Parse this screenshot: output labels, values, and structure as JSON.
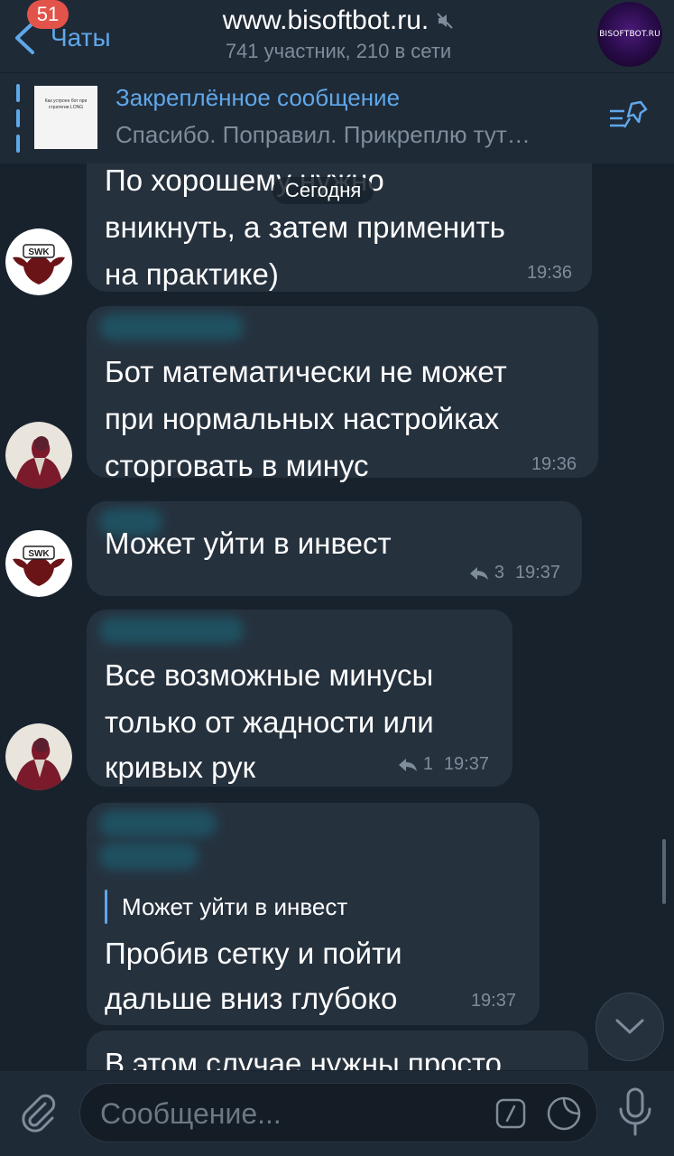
{
  "header": {
    "back_label": "Чаты",
    "unread_badge": "51",
    "title": "www.bisoftbot.ru.",
    "subtitle": "741 участник, 210 в сети",
    "channel_avatar_text": "BISOFTBOT.RU"
  },
  "pinned": {
    "title": "Закреплённое сообщение",
    "text": "Спасибо. Поправил. Прикреплю тут…",
    "thumb_text": "Как устроен бот при стратегии LONG"
  },
  "date_pill": "Сегодня",
  "messages": [
    {
      "lines": [
        "По хорошему нужно",
        "вникнуть, а затем применить",
        "на практике)"
      ],
      "time": "19:36",
      "avatar": "swk-bull"
    },
    {
      "lines": [
        "Бот математически не может",
        "при нормальных настройках",
        "сторговать в минус"
      ],
      "time": "19:36",
      "avatar": "user-photo"
    },
    {
      "lines": [
        "Может уйти в инвест"
      ],
      "time": "19:37",
      "replies": "3",
      "avatar": "swk-bull"
    },
    {
      "lines": [
        "Все возможные минусы",
        "только от жадности или",
        "кривых рук"
      ],
      "time": "19:37",
      "replies": "1",
      "avatar": "user-photo"
    },
    {
      "quote": "Может уйти в инвест",
      "lines": [
        "Пробив сетку и пойти",
        "дальше вниз глубоко"
      ],
      "time": "19:37"
    },
    {
      "lines": [
        "В этом случае нужны просто"
      ]
    }
  ],
  "avatar_label": "SWK",
  "input": {
    "placeholder": "Сообщение..."
  },
  "colors": {
    "accent": "#5fa8ea",
    "background": "#18222d",
    "bubble": "#26313e",
    "badge": "#e2534a"
  }
}
